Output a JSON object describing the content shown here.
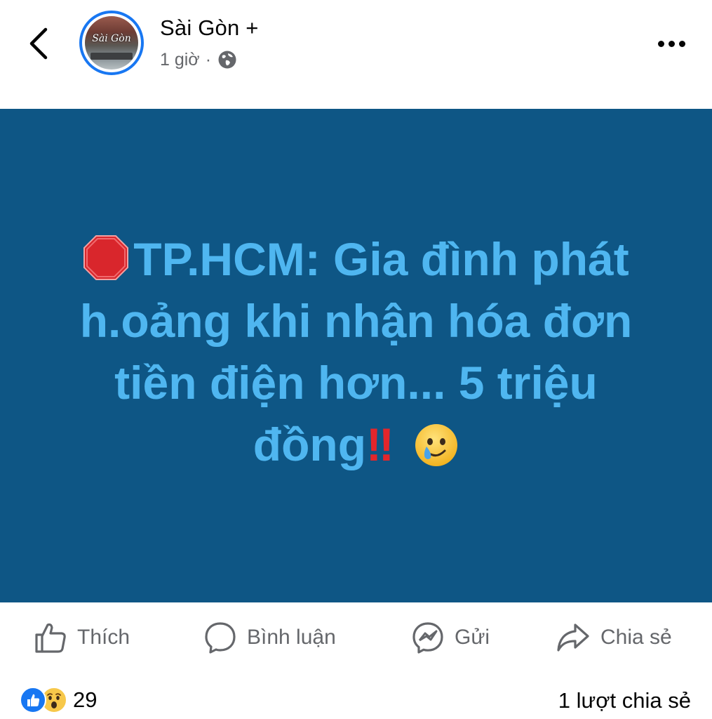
{
  "header": {
    "page_name": "Sài Gòn +",
    "time": "1 giờ",
    "separator": "·",
    "avatar_text": "Sài Gòn"
  },
  "post": {
    "line1": "TP.HCM: Gia đình phát",
    "line2": "h.oảng khi nhận hóa đơn",
    "line3": "tiền điện hơn... 5 triệu",
    "line4": "đồng",
    "exclamation": "‼",
    "background_color": "#0e5685",
    "text_color": "#4fb6f0"
  },
  "actions": {
    "like": "Thích",
    "comment": "Bình luận",
    "send": "Gửi",
    "share": "Chia sẻ"
  },
  "stats": {
    "reaction_count": "29",
    "share_count": "1 lượt chia sẻ",
    "reaction_icons": [
      "like-icon",
      "wow-icon"
    ]
  },
  "icons": {
    "back": "chevron-left-icon",
    "privacy": "globe-icon",
    "more": "more-options-icon"
  }
}
